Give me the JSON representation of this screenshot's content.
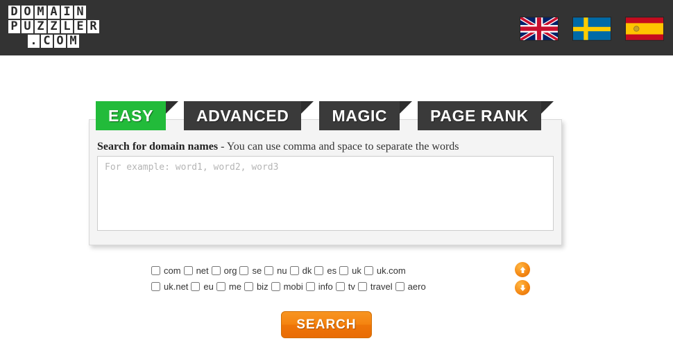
{
  "header": {
    "logo": {
      "line1": "DOMAIN",
      "line2": "PUZZLER",
      "line3": ".COM"
    },
    "languages": [
      {
        "name": "english",
        "label": "United Kingdom"
      },
      {
        "name": "swedish",
        "label": "Sweden"
      },
      {
        "name": "spanish",
        "label": "Spain"
      }
    ]
  },
  "tabs": [
    {
      "label": "EASY",
      "active": true
    },
    {
      "label": "ADVANCED",
      "active": false
    },
    {
      "label": "MAGIC",
      "active": false
    },
    {
      "label": "PAGE RANK",
      "active": false
    }
  ],
  "panel": {
    "label_bold": "Search for domain names",
    "label_rest": " - You can use comma and space to separate the words",
    "textarea_value": "",
    "textarea_placeholder": "For example: word1, word2, word3"
  },
  "tlds": {
    "row1": [
      "com",
      "net",
      "org",
      "se",
      "nu",
      "dk",
      "es",
      "uk",
      "uk.com"
    ],
    "row2": [
      "uk.net",
      "eu",
      "me",
      "biz",
      "mobi",
      "info",
      "tv",
      "travel",
      "aero"
    ]
  },
  "arrows": {
    "up": "▲",
    "down": "▼"
  },
  "actions": {
    "search_label": "SEARCH"
  },
  "colors": {
    "header_bg": "#333333",
    "tab_active": "#22bb3a",
    "tab_inactive": "#3a3a3a",
    "accent_orange": "#f58410",
    "panel_bg": "#f4f4f4"
  }
}
